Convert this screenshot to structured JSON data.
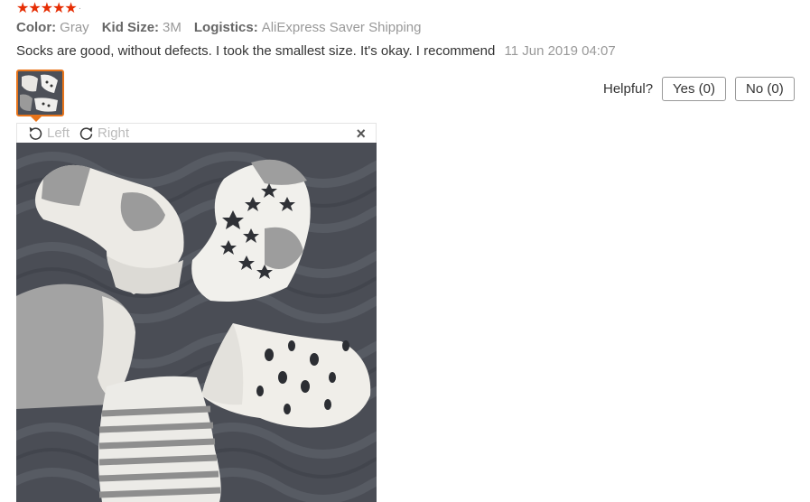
{
  "review": {
    "rating": 5,
    "attributes": [
      {
        "key": "Color:",
        "value": "Gray"
      },
      {
        "key": "Kid Size:",
        "value": "3M"
      },
      {
        "key": "Logistics:",
        "value": "AliExpress Saver Shipping"
      }
    ],
    "comment": "Socks are good, without defects. I took the smallest size. It's okay. I recommend",
    "date": "11 Jun 2019 04:07"
  },
  "helpful": {
    "label": "Helpful?",
    "yes_label": "Yes (0)",
    "no_label": "No (0)"
  },
  "viewer": {
    "rotate_left_label": "Left",
    "rotate_right_label": "Right",
    "close_symbol": "×"
  },
  "colors": {
    "star": "#e62e04",
    "thumb_border": "#e8741a",
    "blanket": "#4d5058"
  }
}
